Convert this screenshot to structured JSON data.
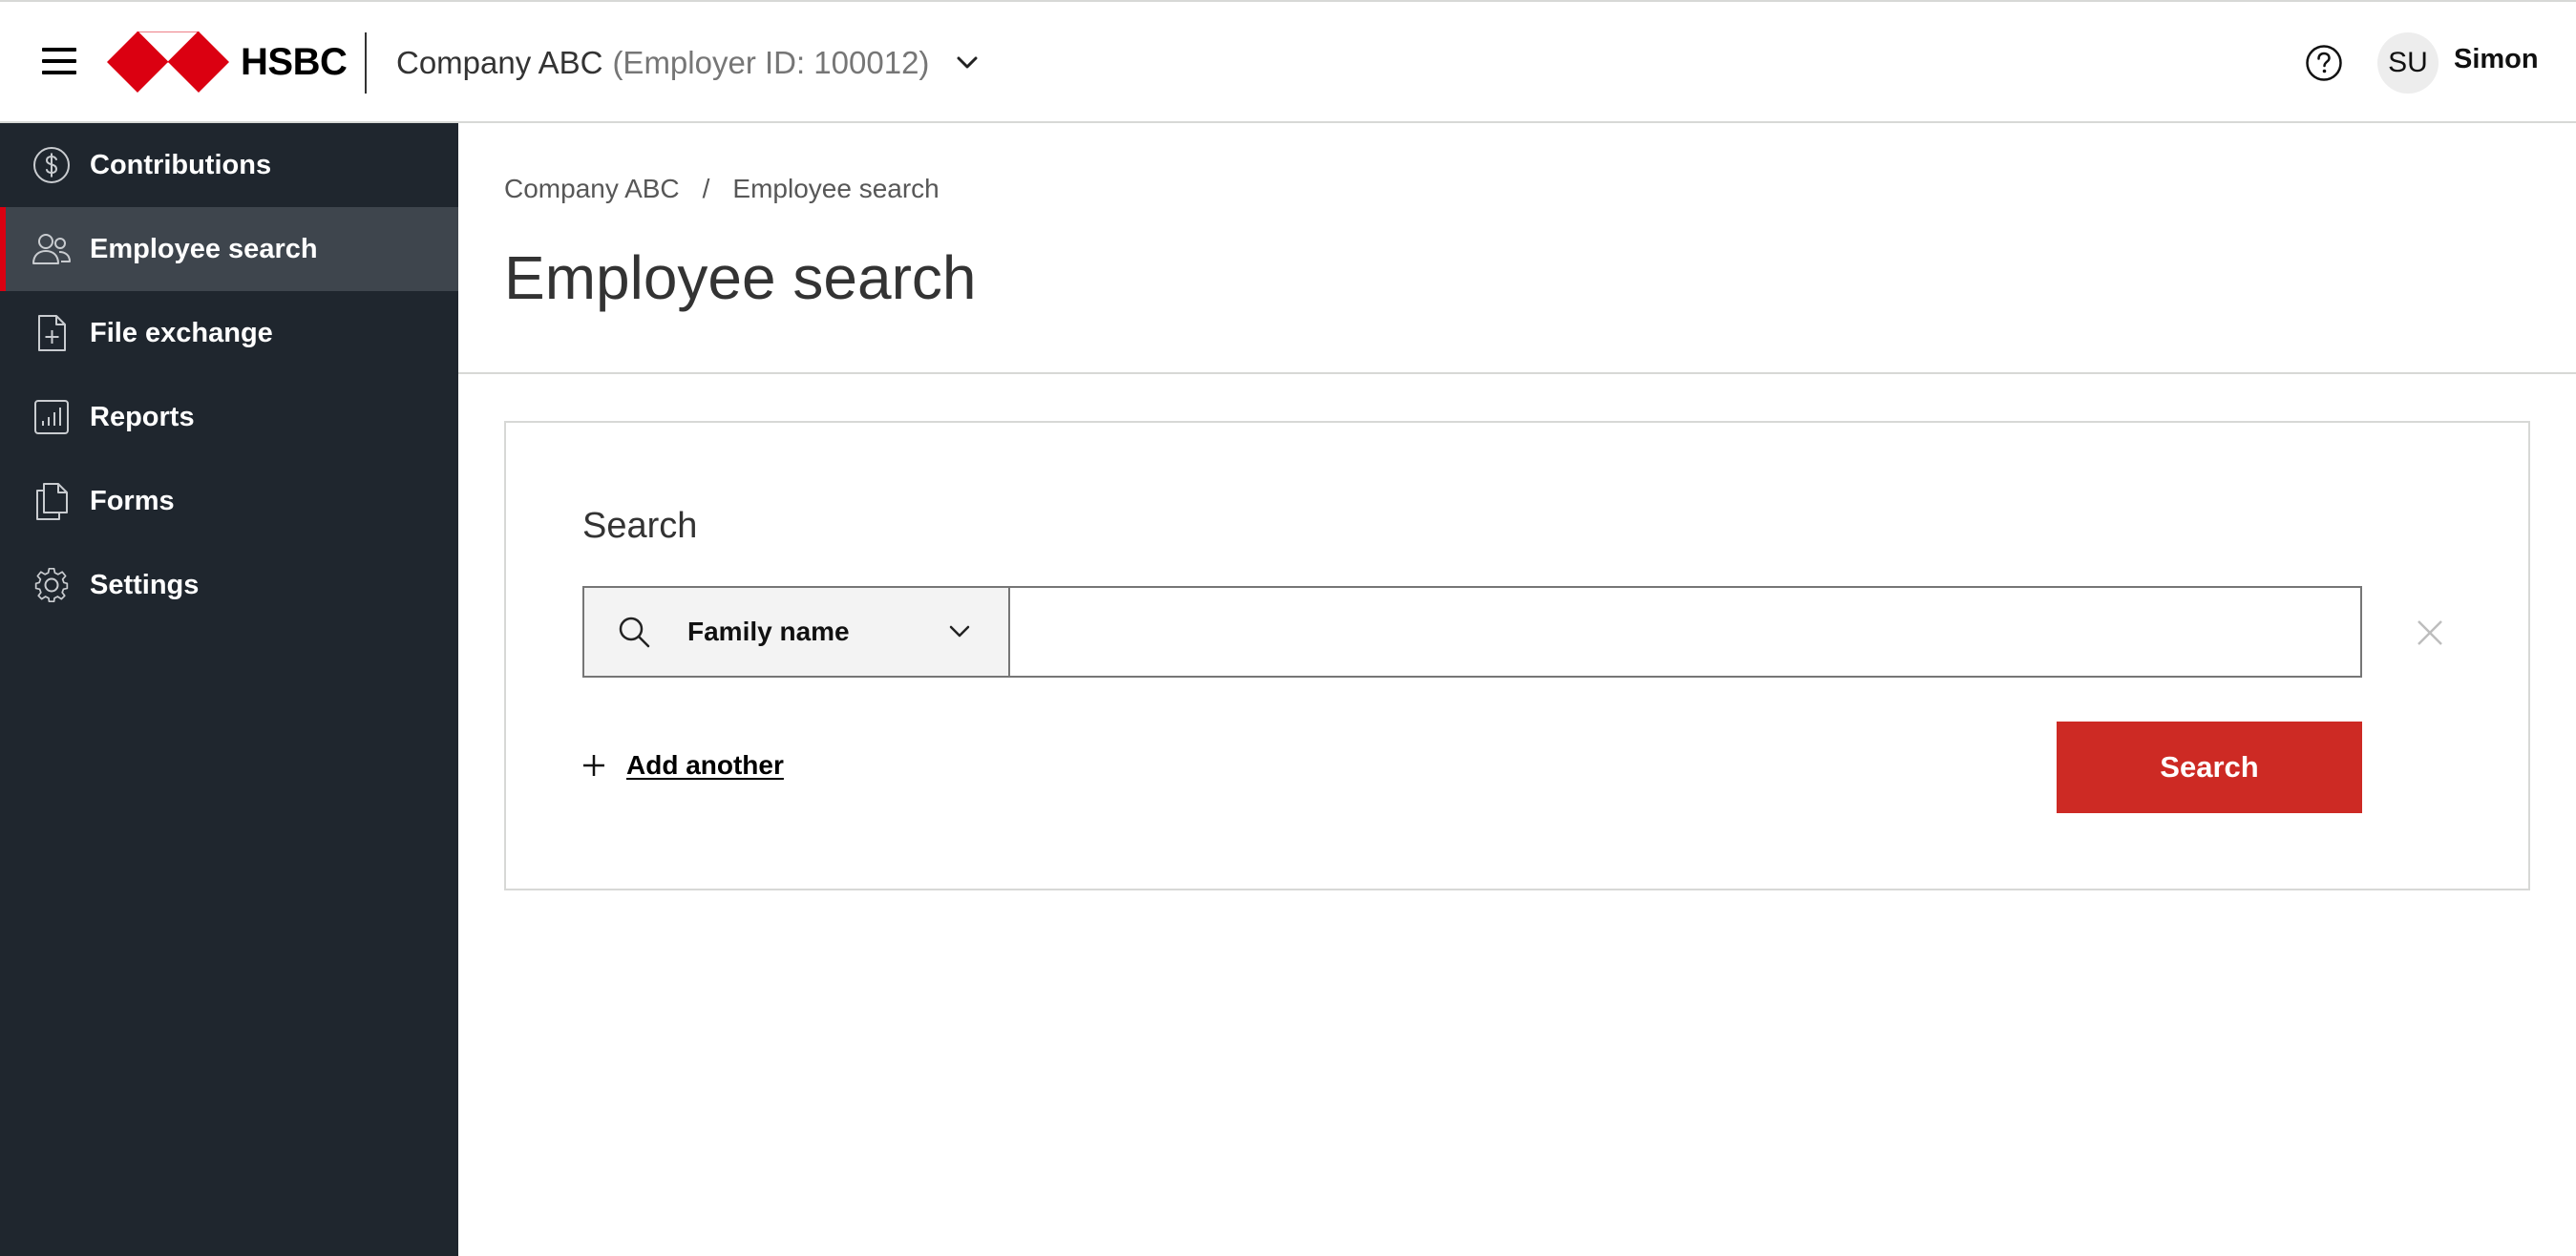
{
  "header": {
    "logo_text": "HSBC",
    "company_name": "Company ABC",
    "employer_id": "(Employer ID: 100012)",
    "user_initials": "SU",
    "user_name": "Simon",
    "icons": {
      "menu": "hamburger-icon",
      "company_switch": "chevron-down-icon",
      "help": "help-icon"
    },
    "brand_color": "#db0011"
  },
  "sidebar": {
    "background": "#1f262e",
    "active_background": "#3e454d",
    "items": [
      {
        "label": "Contributions",
        "icon": "dollar-circle-icon",
        "active": false
      },
      {
        "label": "Employee search",
        "icon": "users-icon",
        "active": true
      },
      {
        "label": "File exchange",
        "icon": "file-add-icon",
        "active": false
      },
      {
        "label": "Reports",
        "icon": "bar-chart-icon",
        "active": false
      },
      {
        "label": "Forms",
        "icon": "documents-icon",
        "active": false
      },
      {
        "label": "Settings",
        "icon": "gear-icon",
        "active": false
      }
    ]
  },
  "main": {
    "breadcrumb": [
      "Company ABC",
      "Employee search"
    ],
    "breadcrumb_separator": "/",
    "title": "Employee search",
    "search_card": {
      "title": "Search",
      "field_selected": "Family name",
      "input_value": "",
      "add_another_label": "Add another",
      "search_button_label": "Search",
      "search_button_color": "#cd2a24"
    }
  }
}
